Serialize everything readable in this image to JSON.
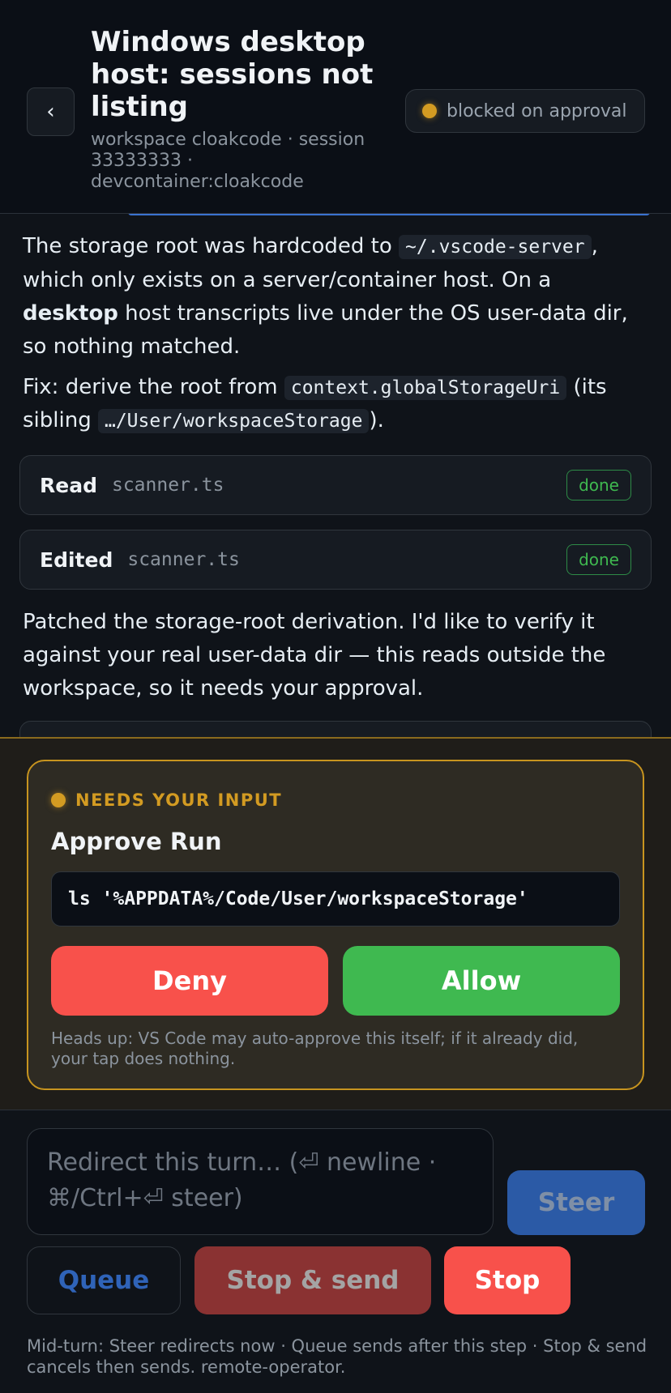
{
  "header": {
    "back_label": "‹",
    "title": "Windows desktop host: sessions not listing",
    "subtitle": "workspace cloakcode · session 33333333 · devcontainer:cloakcode",
    "status": "blocked on approval"
  },
  "transcript": {
    "para1": {
      "t1": "The storage root was hardcoded to ",
      "code1": "~/.vscode-server",
      "t2": ", which only exists on a server/container host. On a ",
      "bold": "desktop",
      "t3": " host transcripts live under the OS user-data dir, so nothing matched."
    },
    "para2": {
      "t1": "Fix: derive the root from ",
      "code1": "context.globalStorageUri",
      "t2": " (its sibling ",
      "code2": "…/User/workspaceStorage",
      "t3": ")."
    },
    "tools": [
      {
        "verb": "Read",
        "file": "scanner.ts",
        "status": "done"
      },
      {
        "verb": "Edited",
        "file": "scanner.ts",
        "status": "done"
      }
    ],
    "para3": "Patched the storage-root derivation. I'd like to verify it against your real user-data dir — this reads outside the workspace, so it needs your approval."
  },
  "approval": {
    "label": "NEEDS YOUR INPUT",
    "title": "Approve Run",
    "command": "ls '%APPDATA%/Code/User/workspaceStorage'",
    "deny": "Deny",
    "allow": "Allow",
    "note": "Heads up: VS Code may auto-approve this itself; if it already did, your tap does nothing."
  },
  "composer": {
    "placeholder": "Redirect this turn…  (⏎ newline · ⌘/Ctrl+⏎ steer)",
    "steer": "Steer",
    "queue": "Queue",
    "stop_send": "Stop & send",
    "stop": "Stop",
    "hint": "Mid-turn: Steer redirects now · Queue sends after this step · Stop & send cancels then sends. remote-operator."
  },
  "colors": {
    "accent_amber": "#d39b22",
    "deny_red": "#f8514b",
    "allow_green": "#3fb950",
    "steer_blue": "#2b5aa6"
  },
  "icons": {
    "back": "chevron-left-icon",
    "status": "status-dot-icon"
  }
}
